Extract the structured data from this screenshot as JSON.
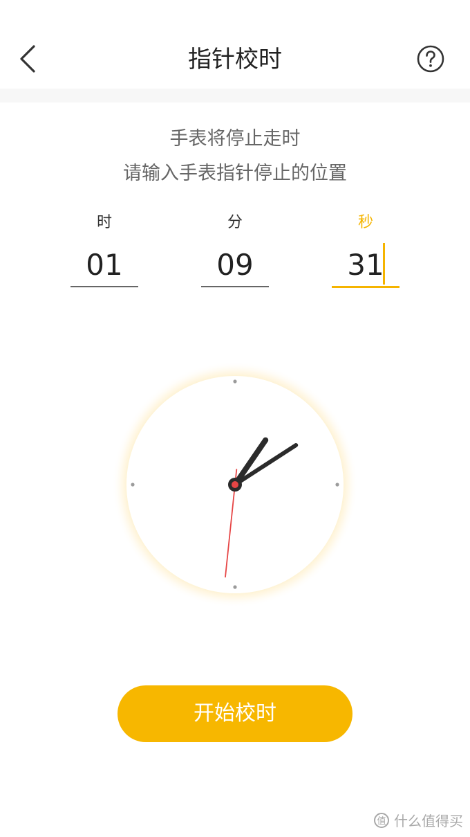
{
  "header": {
    "title": "指针校时",
    "back_icon": "chevron-left-icon",
    "help_icon": "help-circle-icon"
  },
  "instructions": {
    "line1": "手表将停止走时",
    "line2": "请输入手表指针停止的位置"
  },
  "time_fields": {
    "hour": {
      "label": "时",
      "value": "01"
    },
    "minute": {
      "label": "分",
      "value": "09"
    },
    "second": {
      "label": "秒",
      "value": "31",
      "active": true
    }
  },
  "clock": {
    "hours": 1,
    "minutes": 9,
    "seconds": 31
  },
  "start_button": {
    "label": "开始校时"
  },
  "watermark": {
    "text": "什么值得买"
  },
  "colors": {
    "accent": "#f7b700",
    "second_hand": "#e64545",
    "hand": "#2b2b2b"
  }
}
